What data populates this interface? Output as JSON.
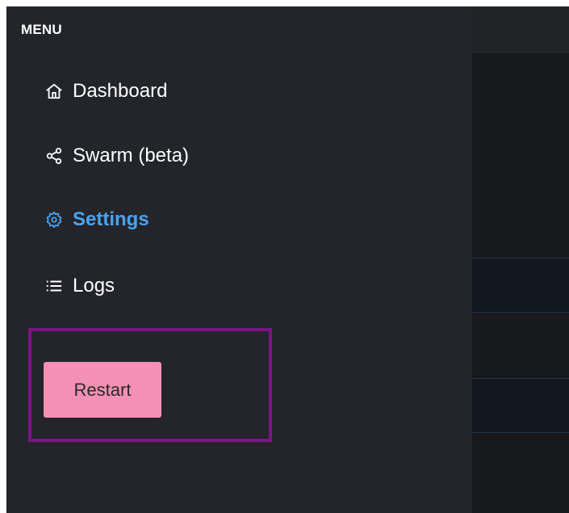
{
  "sidebar": {
    "heading": "MENU",
    "items": [
      {
        "label": "Dashboard",
        "icon": "home-icon",
        "active": false
      },
      {
        "label": "Swarm (beta)",
        "icon": "share-nodes-icon",
        "active": false
      },
      {
        "label": "Settings",
        "icon": "gear-icon",
        "active": true
      },
      {
        "label": "Logs",
        "icon": "list-icon",
        "active": false
      }
    ],
    "restart_label": "Restart"
  },
  "colors": {
    "sidebar_bg": "#23252b",
    "main_bg": "#16181c",
    "active": "#4aa3f0",
    "restart_button": "#f490b4",
    "highlight_border": "#7b1585"
  }
}
